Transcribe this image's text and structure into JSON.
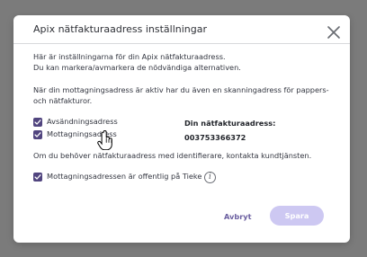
{
  "modal": {
    "title": "Apix nätfakturaadress inställningar",
    "intro_line1": "Här är inställningarna för din Apix nätfakturaadress.",
    "intro_line2": "Du kan markera/avmarkera de nödvändiga alternativen.",
    "notice_line1": "När din mottagningsadress är aktiv har du även en skanningadress för pappers-",
    "notice_line2": "och nätfakturor.",
    "checkbox_sending": "Avsändningsadress",
    "checkbox_receiving": "Mottagningsadress",
    "address_label": "Din nätfakturaadress:",
    "address_value": "003753366372",
    "support_text": "Om du behöver nätfakturaadress med identifierare, kontakta kundtjänsten.",
    "checkbox_public": "Mottagningsadressen är offentlig på Tieke",
    "cancel_label": "Avbryt",
    "save_label": "Spara"
  },
  "icons": {
    "close": "close-icon",
    "checkbox": "checkbox-check-icon",
    "info": "info-icon",
    "cursor": "hand-pointer-icon"
  },
  "colors": {
    "overlay": "#7b7b7b",
    "modal_bg": "#ffffff",
    "checkbox": "#51457f",
    "button_primary_disabled": "#cdc8f2",
    "button_secondary": "#6b5fa0"
  }
}
